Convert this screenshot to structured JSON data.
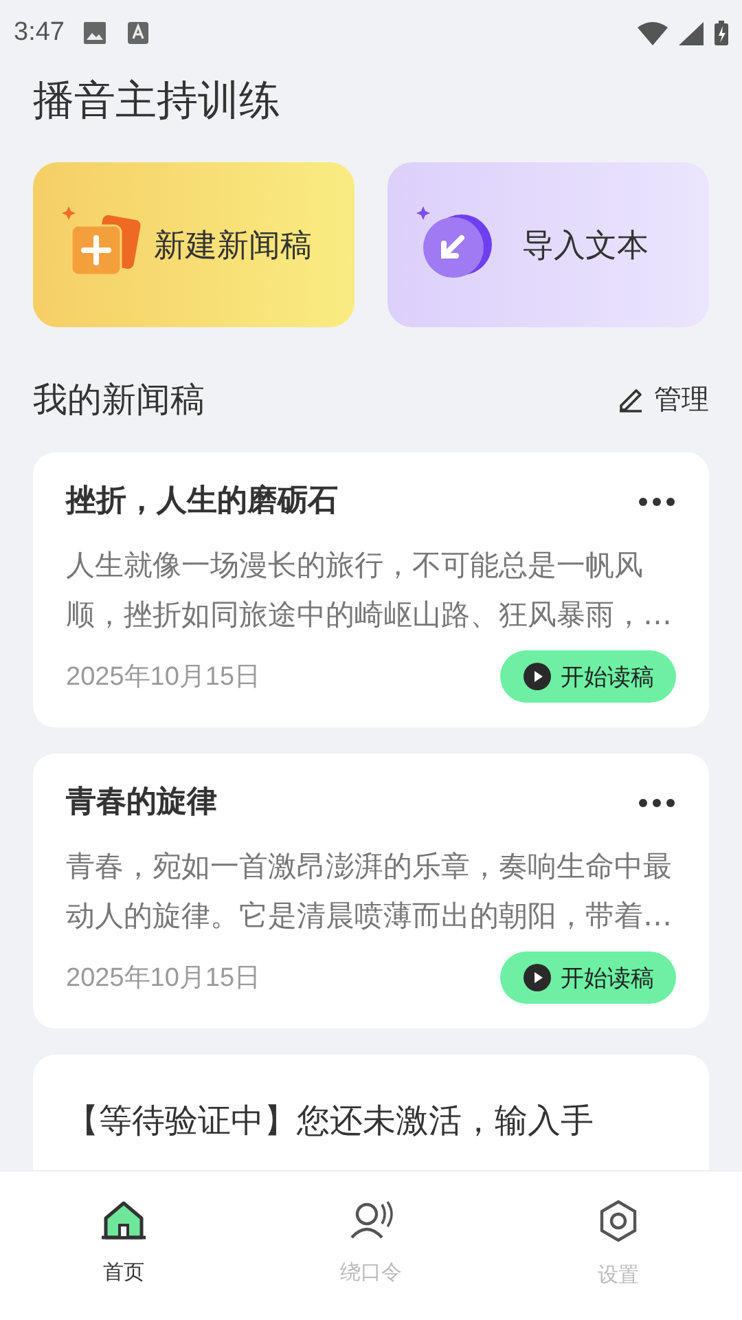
{
  "status_bar": {
    "time": "3:47"
  },
  "title": "播音主持训练",
  "actions": [
    {
      "kind": "new",
      "label": "新建新闻稿"
    },
    {
      "kind": "import",
      "label": "导入文本"
    }
  ],
  "section": {
    "title": "我的新闻稿",
    "manage": "管理"
  },
  "articles": [
    {
      "title": "挫折，人生的磨砺石",
      "excerpt": "人生就像一场漫长的旅行，不可能总是一帆风顺，挫折如同旅途中的崎岖山路、狂风暴雨，…",
      "date": "2025年10月15日",
      "button": "开始读稿"
    },
    {
      "title": "青春的旋律",
      "excerpt": "青春，宛如一首激昂澎湃的乐章，奏响生命中最动人的旋律。它是清晨喷薄而出的朝阳，带着…",
      "date": "2025年10月15日",
      "button": "开始读稿"
    }
  ],
  "notice": "【等待验证中】您还未激活，输入手",
  "tabs": [
    {
      "kind": "home",
      "label": "首页",
      "selected": true
    },
    {
      "kind": "speech",
      "label": "绕口令",
      "selected": false
    },
    {
      "kind": "settings",
      "label": "设置",
      "selected": false
    }
  ]
}
